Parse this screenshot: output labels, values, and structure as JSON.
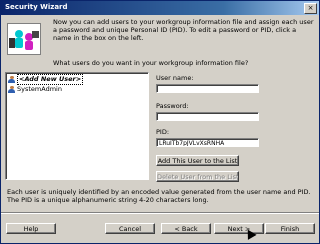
{
  "window": {
    "title": "Security Wizard",
    "close_glyph": "×"
  },
  "intro_text": "Now you can add users to your workgroup information file and assign each user a password and unique Personal ID (PID). To edit a password or PID, click a name in the box on the left.",
  "question": "What users do you want in your workgroup information file?",
  "users": [
    {
      "label": "<Add New User>",
      "icon": "user-icon"
    },
    {
      "label": "SystemAdmin",
      "icon": "user-icon"
    }
  ],
  "form": {
    "user_name_label": "User name:",
    "user_name_value": "",
    "password_label": "Password:",
    "password_value": "",
    "pid_label": "PID:",
    "pid_value": "LRuITb7pJVLvXsRNHA",
    "add_button": "Add This User to the List",
    "delete_button": "Delete User from the List"
  },
  "footer_text": "Each user is uniquely identified by an encoded value generated from the user name and PID. The PID is a unique alphanumeric string 4-20 characters long.",
  "buttons": {
    "help": "Help",
    "cancel": "Cancel",
    "back": "< Back",
    "next": "Next >",
    "finish": "Finish"
  }
}
